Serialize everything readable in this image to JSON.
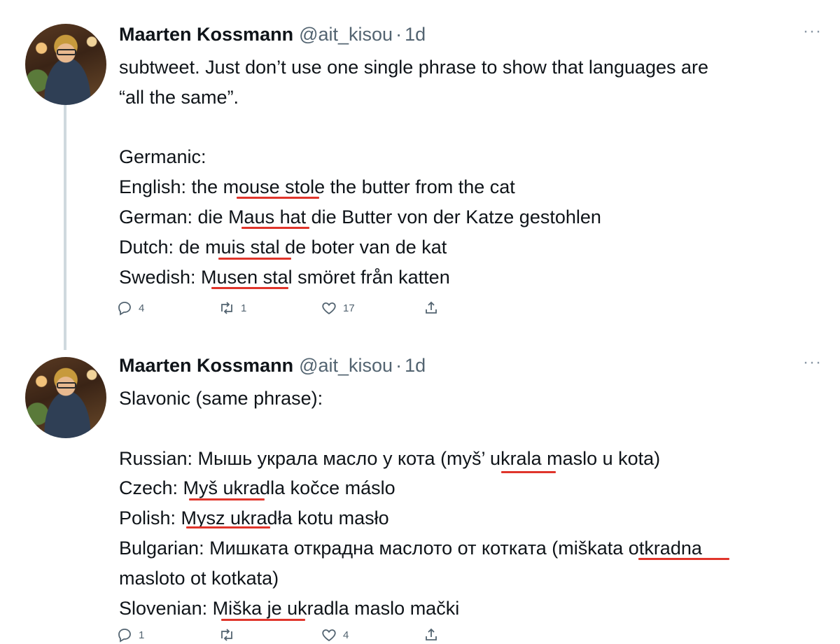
{
  "tweets": [
    {
      "author": {
        "name": "Maarten Kossmann",
        "handle": "@ait_kisou",
        "separator": "·",
        "time": "1d"
      },
      "more_icon": "more-horizontal-icon",
      "lines": [
        "subtweet. Just don’t use one single phrase to show that languages are",
        "“all the same”.",
        "",
        "Germanic:",
        "English: the mouse stole the butter from the cat",
        "German: die Maus hat die Butter von der Katze gestohlen",
        "Dutch: de muis stal de boter van de kat",
        "Swedish: Musen stal smöret från katten"
      ],
      "actions": {
        "reply": "4",
        "retweet": "1",
        "like": "17",
        "share": ""
      }
    },
    {
      "author": {
        "name": "Maarten Kossmann",
        "handle": "@ait_kisou",
        "separator": "·",
        "time": "1d"
      },
      "more_icon": "more-horizontal-icon",
      "lines": [
        "Slavonic (same phrase):",
        "",
        "Russian: Мышь украла масло у кота (myš’ ukrala maslo u kota)",
        "Czech: Myš ukradla kočce máslo",
        "Polish: Mysz ukradła kotu masło",
        "Bulgarian: Мишката откраднa маслото от котката (miškata otkradna",
        "masloto ot kotkata)",
        "Slovenian: Miška je ukradla maslo mački"
      ],
      "actions": {
        "reply": "1",
        "retweet": "",
        "like": "4",
        "share": ""
      }
    }
  ],
  "colors": {
    "text": "#0f1419",
    "secondary": "#536471",
    "underline": "#e0352b",
    "thread": "#cfd9de"
  }
}
